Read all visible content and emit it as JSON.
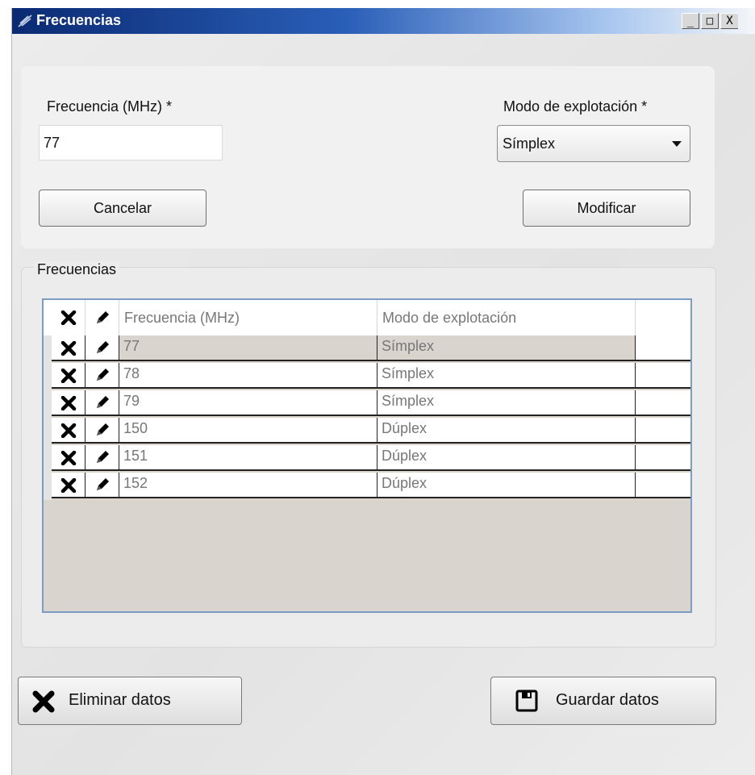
{
  "window": {
    "title": "Frecuencias",
    "min_glyph": "_",
    "max_glyph": "□",
    "close_glyph": "X"
  },
  "form": {
    "freq_label": "Frecuencia (MHz) *",
    "freq_value": "77",
    "mode_label": "Modo de explotación *",
    "mode_selected": "Símplex",
    "cancel_label": "Cancelar",
    "modify_label": "Modificar"
  },
  "group": {
    "title": "Frecuencias",
    "columns": [
      "Frecuencia (MHz)",
      "Modo de explotación"
    ],
    "rows": [
      {
        "freq": "77",
        "mode": "Símplex"
      },
      {
        "freq": "78",
        "mode": "Símplex"
      },
      {
        "freq": "79",
        "mode": "Símplex"
      },
      {
        "freq": "150",
        "mode": "Dúplex"
      },
      {
        "freq": "151",
        "mode": "Dúplex"
      },
      {
        "freq": "152",
        "mode": "Dúplex"
      }
    ],
    "selected_row": 0,
    "row_icons": [
      "close-icon",
      "pencil-icon"
    ]
  },
  "footer": {
    "delete_label": "Eliminar datos",
    "delete_icon": "close-icon",
    "save_label": "Guardar datos",
    "save_icon": "floppy-icon"
  },
  "colors": {
    "title_gradient_start": "#0a2a73",
    "grid_border": "#7d9cc4",
    "grid_empty_bg": "#d9d5ce"
  }
}
